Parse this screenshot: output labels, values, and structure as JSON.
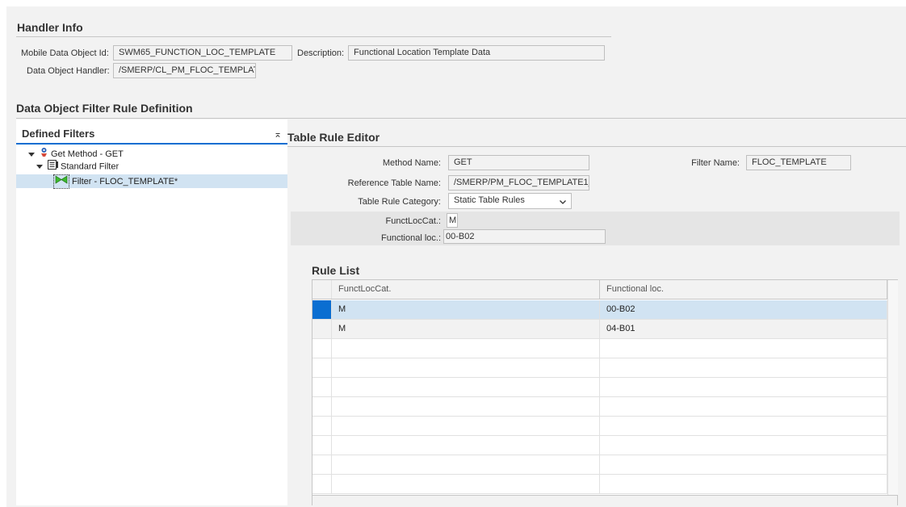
{
  "handler_info": {
    "title": "Handler Info",
    "mobile_data_object_id_label": "Mobile Data Object Id:",
    "mobile_data_object_id_value": "SWM65_FUNCTION_LOC_TEMPLATE",
    "description_label": "Description:",
    "description_value": "Functional Location Template Data",
    "data_object_handler_label": "Data Object Handler:",
    "data_object_handler_value": "/SMERP/CL_PM_FLOC_TEMPLAT"
  },
  "filter_rule_definition": {
    "title": "Data Object Filter Rule Definition"
  },
  "defined_filters": {
    "title": "Defined Filters",
    "collapse_glyph": "⌅",
    "tree": [
      {
        "label": "Get Method - GET",
        "icon": "method-icon"
      },
      {
        "label": "Standard Filter",
        "icon": "list-icon"
      },
      {
        "label": "Filter - FLOC_TEMPLATE*",
        "icon": "filter-icon",
        "selected": true
      }
    ]
  },
  "table_rule_editor": {
    "title": "Table Rule Editor",
    "method_name_label": "Method Name:",
    "method_name_value": "GET",
    "filter_name_label": "Filter Name:",
    "filter_name_value": "FLOC_TEMPLATE",
    "reference_table_label": "Reference Table Name:",
    "reference_table_value": "/SMERP/PM_FLOC_TEMPLATE1_",
    "category_label": "Table Rule Category:",
    "category_value": "Static Table Rules",
    "functlocat_label": "FunctLocCat.:",
    "functlocat_value": "M",
    "functional_loc_label": "Functional loc.:",
    "functional_loc_value": "00-B02"
  },
  "rule_list": {
    "title": "Rule List",
    "columns": [
      "FunctLocCat.",
      "Functional loc."
    ],
    "rows": [
      {
        "functlocat": "M",
        "functional_loc": "00-B02",
        "selected": true
      },
      {
        "functlocat": "M",
        "functional_loc": "04-B01",
        "selected": false
      }
    ],
    "colors": {
      "selected_row": "#d1e3f2",
      "selector_blue": "#0a6ed1",
      "alt_row": "#f2f2f2"
    }
  }
}
